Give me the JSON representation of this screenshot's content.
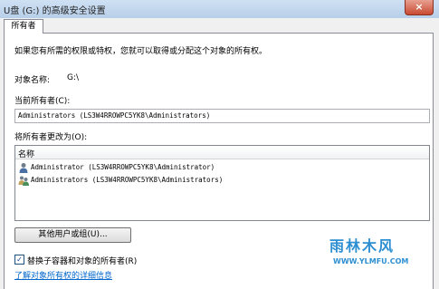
{
  "window": {
    "title": "U盘 (G:) 的高级安全设置",
    "close_symbol": "×"
  },
  "tabs": [
    {
      "label": "所有者"
    }
  ],
  "description": "如果您有所需的权限或特权，您就可以取得或分配这个对象的所有权。",
  "object_name": {
    "label": "对象名称:",
    "value": "G:\\"
  },
  "current_owner": {
    "label": "当前所有者(C):",
    "value": "Administrators (LS3W4RROWPC5YK8\\Administrators)"
  },
  "change_owner": {
    "label": "将所有者更改为(O):"
  },
  "owner_list": {
    "column_name": "名称",
    "items": [
      {
        "label": "Administrator (LS3W4RROWPC5YK8\\Administrator)",
        "icon": "user-icon"
      },
      {
        "label": "Administrators (LS3W4RROWPC5YK8\\Administrators)",
        "icon": "user-group-icon"
      }
    ]
  },
  "other_users_button": "其他用户或组(U)...",
  "replace_checkbox": {
    "label": "替换子容器和对象的所有者(R)",
    "checked": true,
    "check_symbol": "✓"
  },
  "help_link": "了解对象所有权的详细信息",
  "watermark": {
    "title": "雨林木风",
    "url": "WWW.YLMFU.COM"
  }
}
